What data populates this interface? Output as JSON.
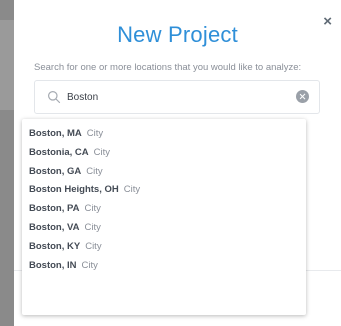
{
  "dialog": {
    "title": "New Project",
    "subtitle": "Search for one or more locations that you would like to analyze:",
    "close_label": "×"
  },
  "search": {
    "value": "Boston",
    "icon": "search-icon",
    "clear_icon": "clear-icon"
  },
  "suggestions": [
    {
      "name": "Boston, MA",
      "type": "City"
    },
    {
      "name": "Bostonia, CA",
      "type": "City"
    },
    {
      "name": "Boston, GA",
      "type": "City"
    },
    {
      "name": "Boston Heights, OH",
      "type": "City"
    },
    {
      "name": "Boston, PA",
      "type": "City"
    },
    {
      "name": "Boston, VA",
      "type": "City"
    },
    {
      "name": "Boston, KY",
      "type": "City"
    },
    {
      "name": "Boston, IN",
      "type": "City"
    }
  ],
  "colors": {
    "title": "#2f8fd8",
    "backdrop": "#8a8a8a",
    "modal": "#ffffff"
  }
}
